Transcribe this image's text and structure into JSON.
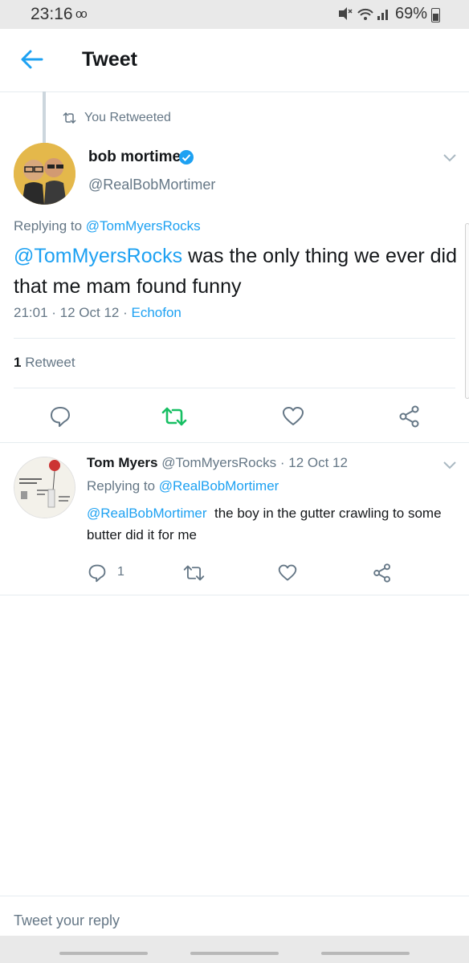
{
  "status_bar": {
    "time": "23:16",
    "voicemail": "oo",
    "battery": "69%"
  },
  "app_bar": {
    "title": "Tweet"
  },
  "main_tweet": {
    "retweet_context": "You Retweeted",
    "author_name": "bob mortimer",
    "author_handle": "@RealBobMortimer",
    "replying_prefix": "Replying to",
    "replying_to": "@TomMyersRocks",
    "text_mention": "@TomMyersRocks",
    "text_body": " was the only thing we ever did that me mam found funny",
    "time": "21:01",
    "date": "12 Oct 12",
    "source": "Echofon",
    "retweet_count": "1",
    "retweet_label": "Retweet",
    "accent_color": "#1da1f2",
    "retweeted_color": "#17bf63"
  },
  "reply_tweet": {
    "author_name": "Tom Myers",
    "author_handle": "@TomMyersRocks",
    "date": "12 Oct 12",
    "replying_prefix": "Replying to",
    "replying_to": "@RealBobMortimer",
    "text_mention": "@RealBobMortimer",
    "text_body": "  the boy in the gutter crawling to some butter did it for me",
    "reply_count": "1"
  },
  "composer": {
    "placeholder": "Tweet your reply"
  }
}
